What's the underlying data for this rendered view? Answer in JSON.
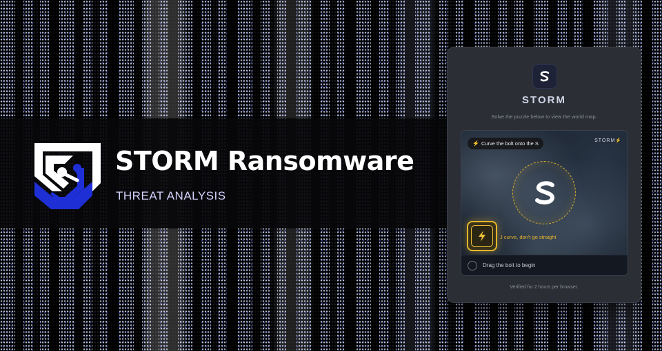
{
  "banner": {
    "title": "STORM Ransomware",
    "subtitle": "THREAT ANALYSIS"
  },
  "card": {
    "title": "STORM",
    "subtitle": "Solve the puzzle below to view the world map.",
    "puzzle": {
      "hint": "Curve the bolt onto the S",
      "brand": "STORM",
      "bolt_hint": "J curve, don't go straight",
      "status": "Drag the bolt to begin"
    },
    "footer": "Verified for 2 hours per browser."
  },
  "colors": {
    "accent_gold": "#e4b52b",
    "logo_blue": "#1f2fd6",
    "card_bg": "#2b2e34",
    "banner_text": "#ffffff",
    "subtitle_text": "#d4d2ff"
  },
  "icons": [
    "storm-logo-icon",
    "lightning-bolt-icon",
    "storm-s-icon",
    "radio-circle-icon"
  ]
}
